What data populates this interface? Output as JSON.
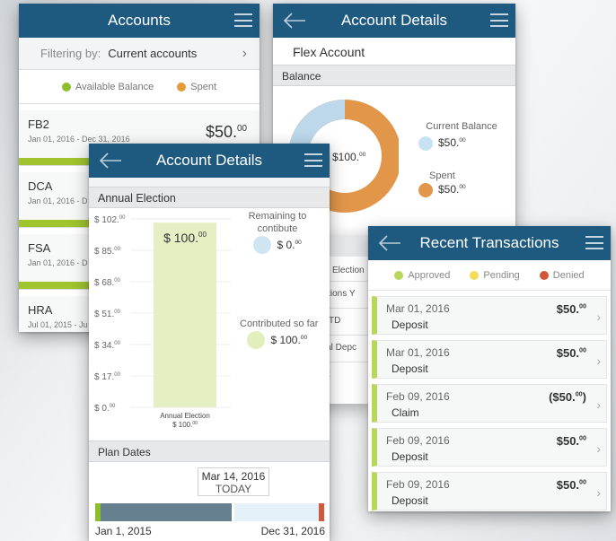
{
  "accounts_screen": {
    "title": "Accounts",
    "filter_label": "Filtering by:",
    "filter_value": "Current accounts",
    "legend": [
      {
        "label": "Available Balance",
        "color": "#8fbe2c"
      },
      {
        "label": "Spent",
        "color": "#e39a37"
      }
    ],
    "accounts": [
      {
        "name": "FB2",
        "dates": "Jan 01, 2016 - Dec 31, 2016",
        "amount": "$50.",
        "cents": "00"
      },
      {
        "name": "DCA",
        "dates": "Jan 01, 2016 - D",
        "amount": "",
        "cents": ""
      },
      {
        "name": "FSA",
        "dates": "Jan 01, 2016 - D",
        "amount": "",
        "cents": ""
      },
      {
        "name": "HRA",
        "dates": "Jul 01, 2015 - Ju",
        "amount": "",
        "cents": ""
      }
    ]
  },
  "details_screen": {
    "title": "Account Details",
    "account_name": "Flex Account",
    "section": "Balance",
    "total": "$100.",
    "total_cents": "00",
    "current_balance_label": "Current Balance",
    "current_balance": "$50.",
    "current_balance_cents": "00",
    "spent_label": "Spent",
    "spent": "$50.",
    "spent_cents": "00",
    "partial_rows": [
      "Election",
      "outions Y",
      "TD",
      "onal Depc",
      "art"
    ]
  },
  "election_screen": {
    "title": "Account Details",
    "section": "Annual Election",
    "chart_data": {
      "type": "bar",
      "categories": [
        "Annual Election"
      ],
      "values": [
        100
      ],
      "ylim": [
        0,
        102
      ],
      "yticks": [
        "$ 102.",
        "$ 85.",
        "$ 68.",
        "$ 51.",
        "$ 34.",
        "$ 17.",
        "$ 0."
      ],
      "tick_cents": "00",
      "bar_label": "$ 100.",
      "bar_label_cents": "00",
      "xlabel": "Annual Election",
      "xsub": "$ 100.",
      "xsub_cents": "00"
    },
    "remaining_label": "Remaining to contibute",
    "remaining": "$ 0.",
    "remaining_cents": "00",
    "contributed_label": "Contributed so far",
    "contributed": "$ 100.",
    "contributed_cents": "00",
    "plan_section": "Plan Dates",
    "today_date": "Mar 14, 2016",
    "today_label": "TODAY",
    "start_date": "Jan 1, 2015",
    "end_date": "Dec 31, 2016"
  },
  "transactions_screen": {
    "title": "Recent Transactions",
    "legend": [
      {
        "label": "Approved",
        "color": "#b7d65b"
      },
      {
        "label": "Pending",
        "color": "#f2dc58"
      },
      {
        "label": "Denied",
        "color": "#d4573a"
      }
    ],
    "items": [
      {
        "date": "Mar 01, 2016",
        "type": "Deposit",
        "amount": "$50.",
        "cents": "00",
        "close": ""
      },
      {
        "date": "Mar 01, 2016",
        "type": "Deposit",
        "amount": "$50.",
        "cents": "00",
        "close": ""
      },
      {
        "date": "Feb 09, 2016",
        "type": "Claim",
        "amount": "($50.",
        "cents": "00",
        "close": ")"
      },
      {
        "date": "Feb 09, 2016",
        "type": "Deposit",
        "amount": "$50.",
        "cents": "00",
        "close": ""
      },
      {
        "date": "Feb 09, 2016",
        "type": "Deposit",
        "amount": "$50.",
        "cents": "00",
        "close": ""
      }
    ]
  }
}
